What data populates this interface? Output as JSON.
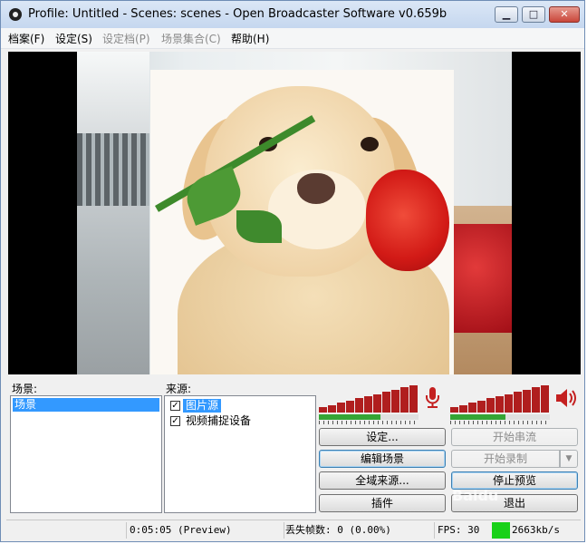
{
  "window": {
    "title": "Profile: Untitled - Scenes: scenes - Open Broadcaster Software v0.659b",
    "min_glyph": "▁",
    "max_glyph": "□",
    "close_glyph": "✕"
  },
  "menu": [
    {
      "label": "档案(F)",
      "disabled": false
    },
    {
      "label": "设定(S)",
      "disabled": false
    },
    {
      "label": "设定档(P)",
      "disabled": true
    },
    {
      "label": "场景集合(C)",
      "disabled": true
    },
    {
      "label": "帮助(H)",
      "disabled": false
    }
  ],
  "scenes": {
    "label": "场景:",
    "items": [
      {
        "name": "场景",
        "selected": true
      }
    ]
  },
  "sources": {
    "label": "来源:",
    "items": [
      {
        "name": "图片源",
        "checked": true,
        "selected": true
      },
      {
        "name": "视频捕捉设备",
        "checked": true,
        "selected": false
      }
    ]
  },
  "audio": {
    "mic_icon": "microphone-icon",
    "speaker_icon": "speaker-icon",
    "mic_level": 0.62,
    "desktop_level": 0.55,
    "mic_volume": 1.0,
    "desktop_volume": 1.0
  },
  "buttons": {
    "settings": "设定...",
    "start_stream": "开始串流",
    "edit_scene": "编辑场景",
    "start_record": "开始录制",
    "global_sources": "全域来源...",
    "stop_preview": "停止预览",
    "plugins": "插件",
    "exit": "退出",
    "record_dropdown": "▼"
  },
  "status": {
    "time": "0:05:05 (Preview)",
    "dropped_frames": "丢失帧数: 0 (0.00%)",
    "fps": "FPS: 30",
    "bitrate": "2663kb/s"
  },
  "watermark": "Baidu"
}
